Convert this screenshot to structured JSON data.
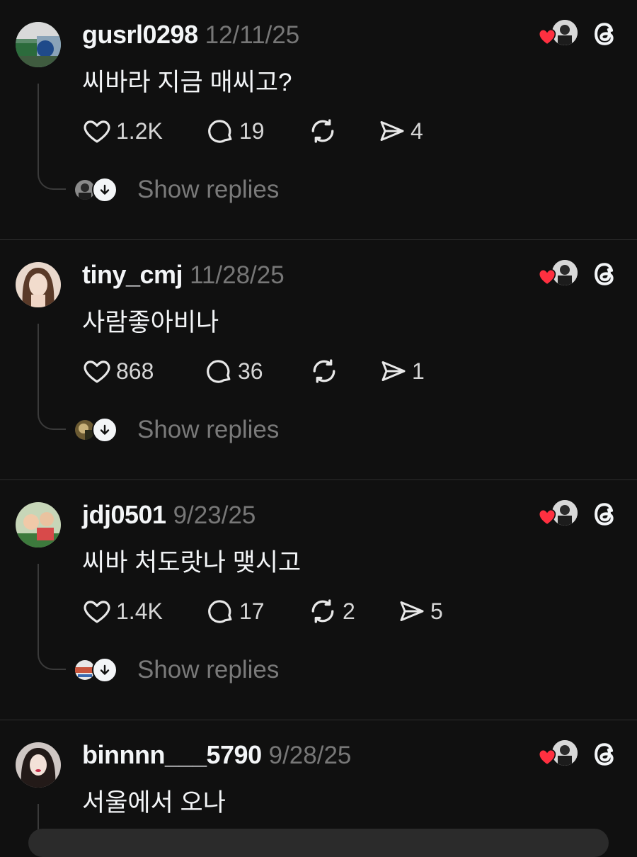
{
  "colors": {
    "background": "#101010",
    "text_primary": "#f3f5f7",
    "text_secondary": "#777777",
    "like_red": "#ff3040"
  },
  "posts": [
    {
      "username": "gusrl0298",
      "date": "12/11/25",
      "text": "씨바라 지금 매씨고?",
      "likes": "1.2K",
      "replies": "19",
      "reposts": "",
      "shares": "4",
      "show_replies": "Show replies"
    },
    {
      "username": "tiny_cmj",
      "date": "11/28/25",
      "text": "사람좋아비나",
      "likes": "868",
      "replies": "36",
      "reposts": "",
      "shares": "1",
      "show_replies": "Show replies"
    },
    {
      "username": "jdj0501",
      "date": "9/23/25",
      "text": "씨바 처도랏나 맺시고",
      "likes": "1.4K",
      "replies": "17",
      "reposts": "2",
      "shares": "5",
      "show_replies": "Show replies"
    },
    {
      "username": "binnnn___5790",
      "date": "9/28/25",
      "text": "서울에서 오나"
    }
  ],
  "icons": {
    "like": "heart-outline-icon",
    "reply": "comment-bubble-icon",
    "repost": "repost-arrows-icon",
    "share": "send-arrow-icon",
    "liked_by_author": "red-heart-icon",
    "app": "threads-logo-icon",
    "expand": "chevron-down-icon"
  }
}
